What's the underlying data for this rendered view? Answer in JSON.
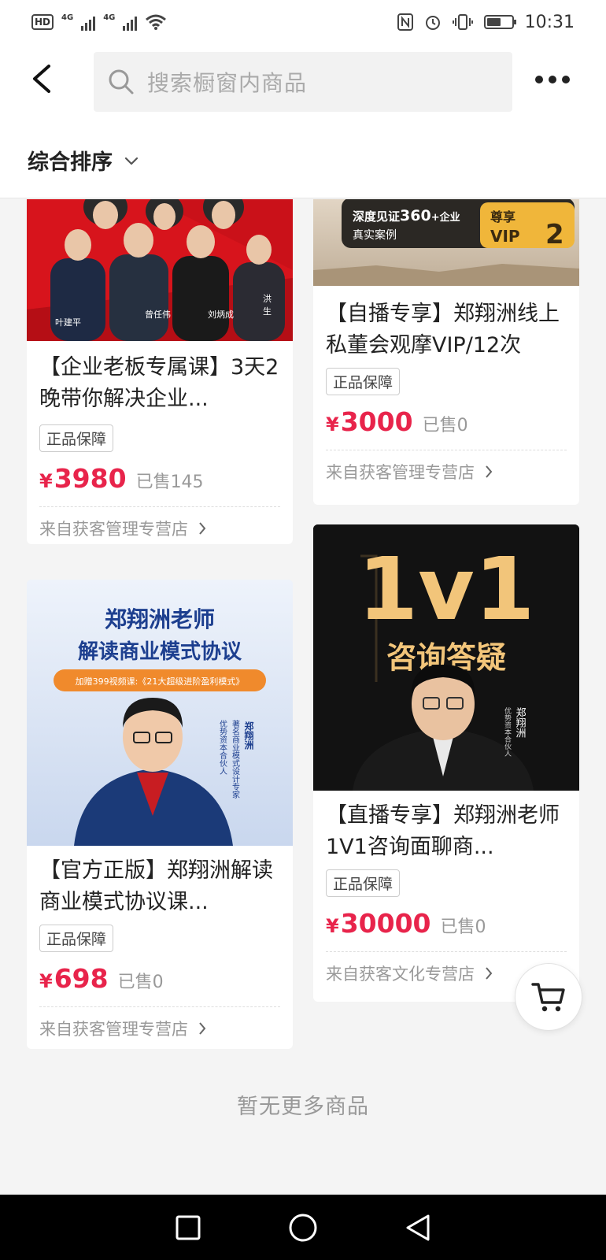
{
  "status": {
    "time": "10:31",
    "hd": "HD",
    "sim1": "4G",
    "sim2": "4G",
    "battery_level": 0.55
  },
  "search": {
    "placeholder": "搜索橱窗内商品"
  },
  "sort": {
    "label": "综合排序"
  },
  "products": [
    {
      "title": "【企业老板专属课】3天2晚带你解决企业...",
      "badge": "正品保障",
      "currency": "¥",
      "price": "3980",
      "sold": "已售145",
      "shop": "来自获客管理专营店",
      "thumb_names": [
        "叶建平",
        "曾任伟",
        "刘炳成",
        "洪",
        "生"
      ]
    },
    {
      "title": "【自播专享】郑翔洲线上私董会观摩VIP/12次",
      "badge": "正品保障",
      "currency": "¥",
      "price": "3000",
      "sold": "已售0",
      "shop": "来自获客管理专营店",
      "thumb_text": {
        "line1": "深度见证",
        "num": "360",
        "line1b": "+企业",
        "line2": "真实案例",
        "tag1": "尊享",
        "tag2": "VIP",
        "tag3": "2"
      }
    },
    {
      "title": "【官方正版】郑翔洲解读商业模式协议课...",
      "badge": "正品保障",
      "currency": "¥",
      "price": "698",
      "sold": "已售0",
      "shop": "来自获客管理专营店",
      "thumb_text": {
        "h1": "郑翔洲老师",
        "h2": "解读商业模式协议",
        "pill": "加赠399视频课:《21大超级进阶盈利模式》",
        "name": "郑翔洲",
        "role1": "著名商业模式设计专家",
        "role2": "优势资本合伙人"
      }
    },
    {
      "title": "【直播专享】郑翔洲老师1V1咨询面聊商...",
      "badge": "正品保障",
      "currency": "¥",
      "price": "30000",
      "sold": "已售0",
      "shop": "来自获客文化专营店",
      "thumb_text": {
        "big": "1v1",
        "sub": "咨询答疑",
        "name": "郑翔洲",
        "role": "优势资本合伙人"
      }
    }
  ],
  "footer": {
    "end_text": "暂无更多商品"
  },
  "icons": {
    "back": "chevron-left-icon",
    "search": "search-icon",
    "more": "more-dots-icon",
    "sort": "chevron-down-icon",
    "cart": "cart-icon"
  },
  "colors": {
    "price": "#e8244b",
    "red_banner": "#d7141c"
  }
}
